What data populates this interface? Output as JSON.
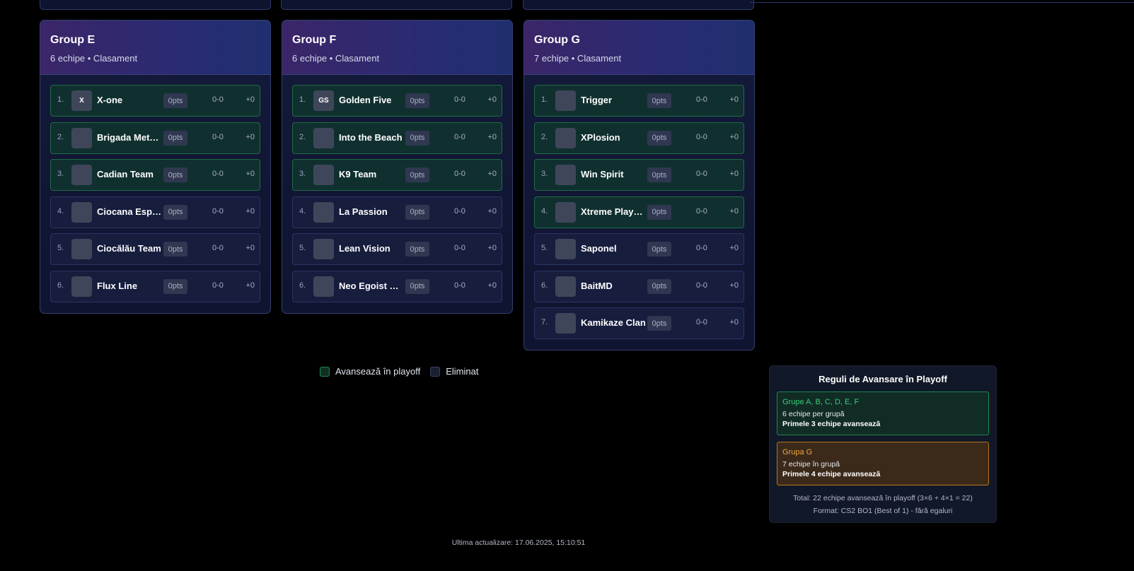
{
  "groups": [
    {
      "title": "Group E",
      "subtitle": "6 echipe • Clasament",
      "teams": [
        {
          "rank": "1.",
          "logo": "X",
          "name": "X-one",
          "pts": "0pts",
          "record": "0-0",
          "diff": "+0",
          "advance": true
        },
        {
          "rank": "2.",
          "logo": "",
          "name": "Brigada Meteor",
          "pts": "0pts",
          "record": "0-0",
          "diff": "+0",
          "advance": true
        },
        {
          "rank": "3.",
          "logo": "",
          "name": "Cadian Team",
          "pts": "0pts",
          "record": "0-0",
          "diff": "+0",
          "advance": true
        },
        {
          "rank": "4.",
          "logo": "",
          "name": "Ciocana Esports",
          "pts": "0pts",
          "record": "0-0",
          "diff": "+0",
          "advance": false
        },
        {
          "rank": "5.",
          "logo": "",
          "name": "Ciocălău Team",
          "pts": "0pts",
          "record": "0-0",
          "diff": "+0",
          "advance": false
        },
        {
          "rank": "6.",
          "logo": "",
          "name": "Flux Line",
          "pts": "0pts",
          "record": "0-0",
          "diff": "+0",
          "advance": false
        }
      ]
    },
    {
      "title": "Group F",
      "subtitle": "6 echipe • Clasament",
      "teams": [
        {
          "rank": "1.",
          "logo": "GS",
          "name": "Golden Five",
          "pts": "0pts",
          "record": "0-0",
          "diff": "+0",
          "advance": true
        },
        {
          "rank": "2.",
          "logo": "",
          "name": "Into the Beach",
          "pts": "0pts",
          "record": "0-0",
          "diff": "+0",
          "advance": true
        },
        {
          "rank": "3.",
          "logo": "",
          "name": "K9 Team",
          "pts": "0pts",
          "record": "0-0",
          "diff": "+0",
          "advance": true
        },
        {
          "rank": "4.",
          "logo": "",
          "name": "La Passion",
          "pts": "0pts",
          "record": "0-0",
          "diff": "+0",
          "advance": false
        },
        {
          "rank": "5.",
          "logo": "",
          "name": "Lean Vision",
          "pts": "0pts",
          "record": "0-0",
          "diff": "+0",
          "advance": false
        },
        {
          "rank": "6.",
          "logo": "",
          "name": "Neo Egoist Le...",
          "pts": "0pts",
          "record": "0-0",
          "diff": "+0",
          "advance": false
        }
      ]
    },
    {
      "title": "Group G",
      "subtitle": "7 echipe • Clasament",
      "teams": [
        {
          "rank": "1.",
          "logo": "",
          "name": "Trigger",
          "pts": "0pts",
          "record": "0-0",
          "diff": "+0",
          "advance": true
        },
        {
          "rank": "2.",
          "logo": "",
          "name": "XPlosion",
          "pts": "0pts",
          "record": "0-0",
          "diff": "+0",
          "advance": true
        },
        {
          "rank": "3.",
          "logo": "",
          "name": "Win Spirit",
          "pts": "0pts",
          "record": "0-0",
          "diff": "+0",
          "advance": true
        },
        {
          "rank": "4.",
          "logo": "",
          "name": "Xtreme Players",
          "pts": "0pts",
          "record": "0-0",
          "diff": "+0",
          "advance": true
        },
        {
          "rank": "5.",
          "logo": "",
          "name": "Saponel",
          "pts": "0pts",
          "record": "0-0",
          "diff": "+0",
          "advance": false
        },
        {
          "rank": "6.",
          "logo": "",
          "name": "BaitMD",
          "pts": "0pts",
          "record": "0-0",
          "diff": "+0",
          "advance": false
        },
        {
          "rank": "7.",
          "logo": "",
          "name": "Kamikaze Clan",
          "pts": "0pts",
          "record": "0-0",
          "diff": "+0",
          "advance": false
        }
      ]
    }
  ],
  "legend": {
    "advance_label": "Avansează în playoff",
    "eliminated_label": "Eliminat"
  },
  "rules": {
    "title": "Reguli de Avansare în Playoff",
    "box1": {
      "heading": "Grupe A, B, C, D, E, F",
      "line": "6 echipe per grupă",
      "bold": "Primele 3 echipe avansează"
    },
    "box2": {
      "heading": "Grupa G",
      "line": "7 echipe în grupă",
      "bold": "Primele 4 echipe avansează"
    },
    "total": "Total: 22 echipe avansează în playoff (3×6 + 4×1 = 22)",
    "format": "Format: CS2 BO1 (Best of 1) - fără egaluri"
  },
  "updated": "Ultima actualizare: 17.06.2025, 15:10:51",
  "colors": {
    "advance_bg": "#10302f",
    "advance_border": "#1f6b45",
    "rule_green": "#35d07a",
    "rule_orange": "#f2a63a"
  }
}
